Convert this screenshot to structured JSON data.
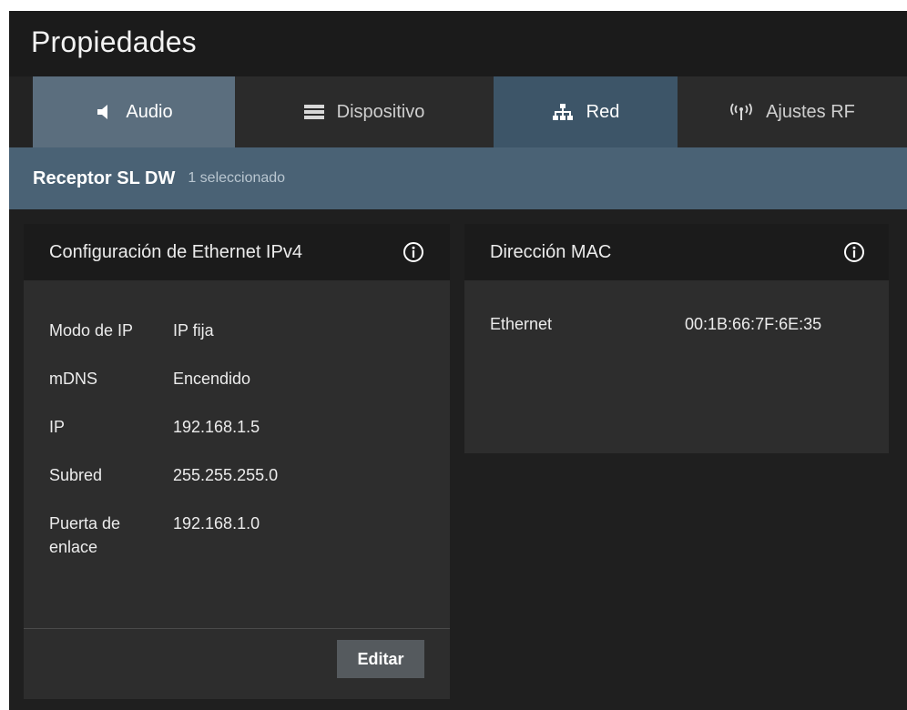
{
  "window": {
    "title": "Propiedades"
  },
  "tabs": [
    {
      "label": "Audio",
      "icon": "speaker-icon"
    },
    {
      "label": "Dispositivo",
      "icon": "device-icon"
    },
    {
      "label": "Red",
      "icon": "network-icon"
    },
    {
      "label": "Ajustes RF",
      "icon": "antenna-icon"
    }
  ],
  "active_tab": "Red",
  "subheader": {
    "device_name": "Receptor SL DW",
    "selected_count": "1 seleccionado"
  },
  "ethernet_panel": {
    "title": "Configuración de Ethernet IPv4",
    "rows": [
      {
        "label": "Modo de IP",
        "value": "IP fija"
      },
      {
        "label": "mDNS",
        "value": "Encendido"
      },
      {
        "label": "IP",
        "value": "192.168.1.5"
      },
      {
        "label": "Subred",
        "value": "255.255.255.0"
      },
      {
        "label": "Puerta de enlace",
        "value": "192.168.1.0"
      }
    ],
    "edit_button": "Editar"
  },
  "mac_panel": {
    "title": "Dirección MAC",
    "label": "Ethernet",
    "value": "00:1B:66:7F:6E:35"
  },
  "colors": {
    "window_bg": "#1f1f1f",
    "audio_tab": "#5b6e7e",
    "network_tab": "#3d5568",
    "subheader": "#4a6275",
    "panel_bg": "#2d2d2d",
    "panel_header": "#1b1b1b"
  }
}
